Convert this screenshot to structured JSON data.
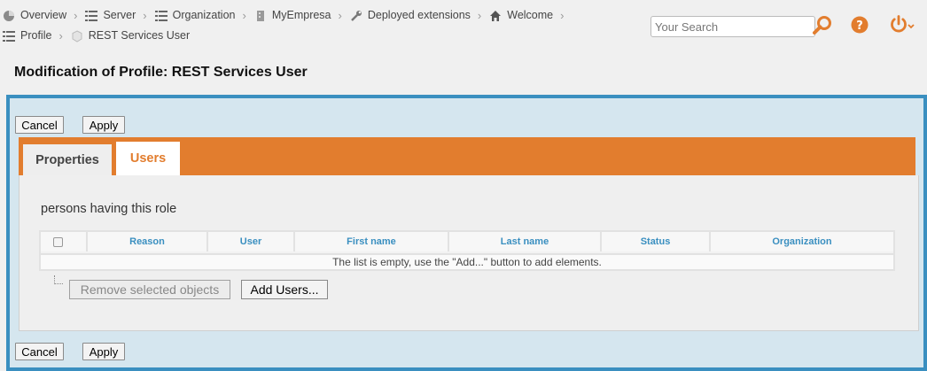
{
  "breadcrumb": {
    "line1": [
      {
        "label": "Overview",
        "icon": "pie-chart-icon"
      },
      {
        "label": "Server",
        "icon": "list-icon"
      },
      {
        "label": "Organization",
        "icon": "list-icon"
      },
      {
        "label": "MyEmpresa",
        "icon": "building-icon"
      },
      {
        "label": "Deployed extensions",
        "icon": "wrench-icon"
      },
      {
        "label": "Welcome",
        "icon": "home-icon"
      }
    ],
    "line2": [
      {
        "label": "Profile",
        "icon": "list-icon"
      },
      {
        "label": "REST Services User",
        "icon": "profile-icon"
      }
    ]
  },
  "search": {
    "placeholder": "Your Search"
  },
  "colors": {
    "accent": "#e27d2e",
    "frame": "#3a8fc0",
    "frame_bg": "#d5e6ef",
    "header_text": "#3a8fc0"
  },
  "page": {
    "title": "Modification of Profile: REST Services User"
  },
  "top_actions": {
    "cancel": "Cancel",
    "apply": "Apply"
  },
  "bottom_actions": {
    "cancel": "Cancel",
    "apply": "Apply"
  },
  "tabs": [
    {
      "label": "Properties",
      "active": false
    },
    {
      "label": "Users",
      "active": true
    }
  ],
  "users_panel": {
    "section_label": "persons having this role",
    "columns": [
      "Reason",
      "User",
      "First name",
      "Last name",
      "Status",
      "Organization"
    ],
    "empty_message": "The list is empty, use the \"Add...\" button to add elements.",
    "remove_label": "Remove selected objects",
    "add_label": "Add Users..."
  }
}
